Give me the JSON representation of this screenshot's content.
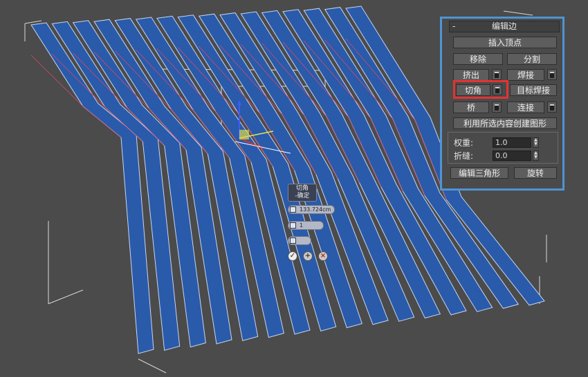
{
  "panel": {
    "title": "编辑边",
    "collapse_symbol": "-",
    "insert_vertex": "插入顶点",
    "remove": "移除",
    "split": "分割",
    "extrude": "挤出",
    "weld": "焊接",
    "chamfer": "切角",
    "target_weld": "目标焊接",
    "bridge": "桥",
    "connect": "连接",
    "create_shape": "利用所选内容创建图形",
    "weight_label": "权重:",
    "weight_value": "1.0",
    "crease_label": "折缝:",
    "crease_value": "0.0",
    "edit_tri": "编辑三角形",
    "turn": "旋转"
  },
  "caddy": {
    "title_line1": "切角",
    "title_line2": "-确定",
    "amount": "133.724cm",
    "segments": "1"
  },
  "colors": {
    "panel_border": "#4f94d3",
    "highlight": "#e53232",
    "mesh_blue": "#2a5aaa",
    "background": "#4b4b4b"
  }
}
